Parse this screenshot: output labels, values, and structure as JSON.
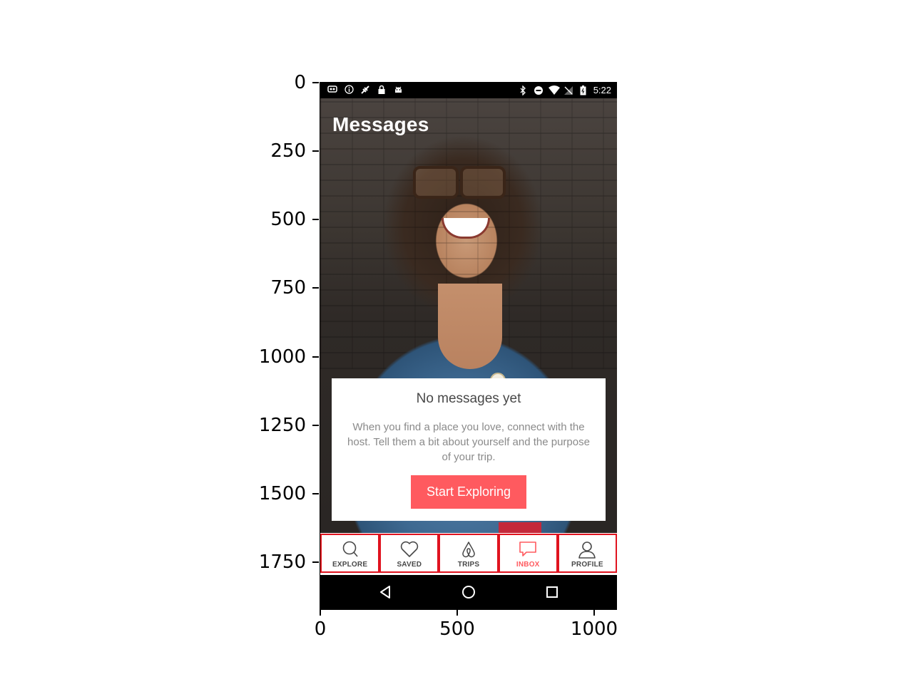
{
  "axes": {
    "y_ticks": [
      "0",
      "250",
      "500",
      "750",
      "1000",
      "1250",
      "1500",
      "1750"
    ],
    "x_ticks": [
      "0",
      "500",
      "1000"
    ]
  },
  "statusbar": {
    "time": "5:22",
    "left_icons": [
      "notification-icon",
      "info-icon",
      "satellite-icon",
      "lock-icon",
      "android-icon"
    ],
    "right_icons": [
      "bluetooth-icon",
      "do-not-disturb-icon",
      "wifi-icon",
      "no-signal-icon",
      "battery-icon"
    ]
  },
  "header": {
    "title": "Messages"
  },
  "empty_state": {
    "title": "No messages yet",
    "body": "When you find a place you love, connect with the host. Tell them a bit about yourself and the purpose of your trip.",
    "cta_label": "Start Exploring"
  },
  "tabs": [
    {
      "label": "EXPLORE",
      "icon": "search-icon",
      "active": false
    },
    {
      "label": "SAVED",
      "icon": "heart-icon",
      "active": false
    },
    {
      "label": "TRIPS",
      "icon": "airbnb-logo-icon",
      "active": false
    },
    {
      "label": "INBOX",
      "icon": "chat-bubble-icon",
      "active": true
    },
    {
      "label": "PROFILE",
      "icon": "person-icon",
      "active": false
    }
  ],
  "colors": {
    "accent": "#ff5a5f",
    "highlight_border": "#e0131f"
  }
}
